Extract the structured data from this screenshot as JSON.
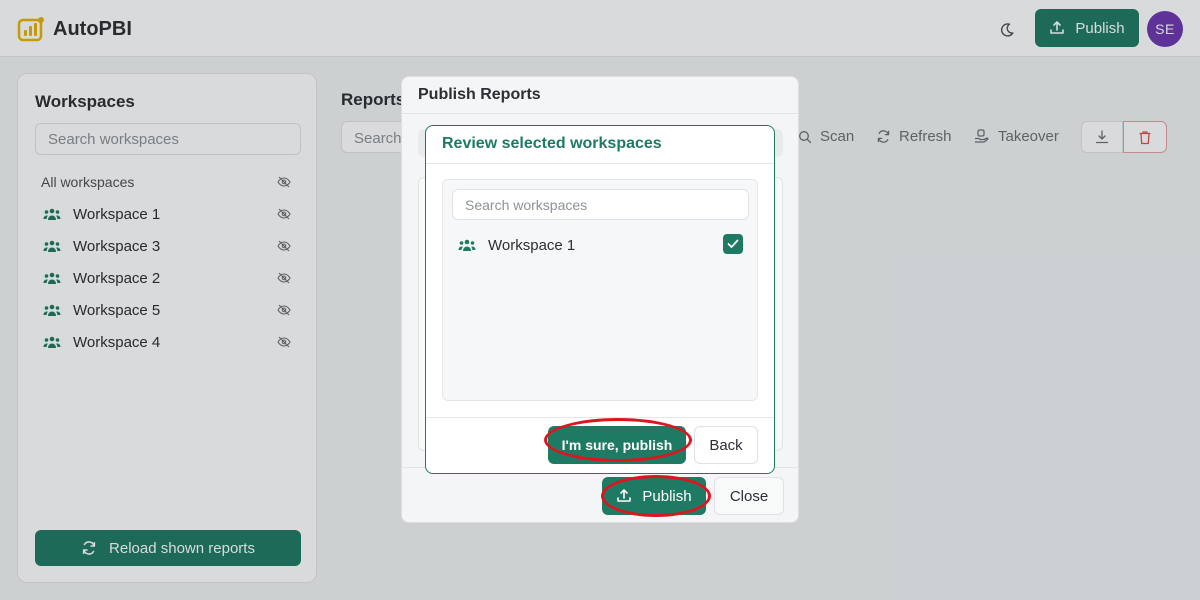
{
  "app": {
    "title": "AutoPBI",
    "publish_label": "Publish",
    "avatar_initials": "SE",
    "brand_color": "#1f7a63",
    "avatar_color": "#6d37b0"
  },
  "sidebar": {
    "title": "Workspaces",
    "search_placeholder": "Search workspaces",
    "all_label": "All workspaces",
    "items": [
      {
        "label": "Workspace 1"
      },
      {
        "label": "Workspace 3"
      },
      {
        "label": "Workspace 2"
      },
      {
        "label": "Workspace 5"
      },
      {
        "label": "Workspace 4"
      }
    ],
    "reload_label": "Reload shown reports"
  },
  "main": {
    "title": "Reports",
    "search_placeholder": "Search",
    "toolbar": {
      "scan_label": "Scan",
      "refresh_label": "Refresh",
      "takeover_label": "Takeover"
    }
  },
  "publish_modal": {
    "title": "Publish Reports",
    "publish_label": "Publish",
    "close_label": "Close"
  },
  "review_dialog": {
    "title": "Review selected workspaces",
    "search_placeholder": "Search workspaces",
    "items": [
      {
        "label": "Workspace 1",
        "checked": true
      }
    ],
    "confirm_label": "I'm sure, publish",
    "back_label": "Back"
  },
  "annotation_color": "#e0141e"
}
